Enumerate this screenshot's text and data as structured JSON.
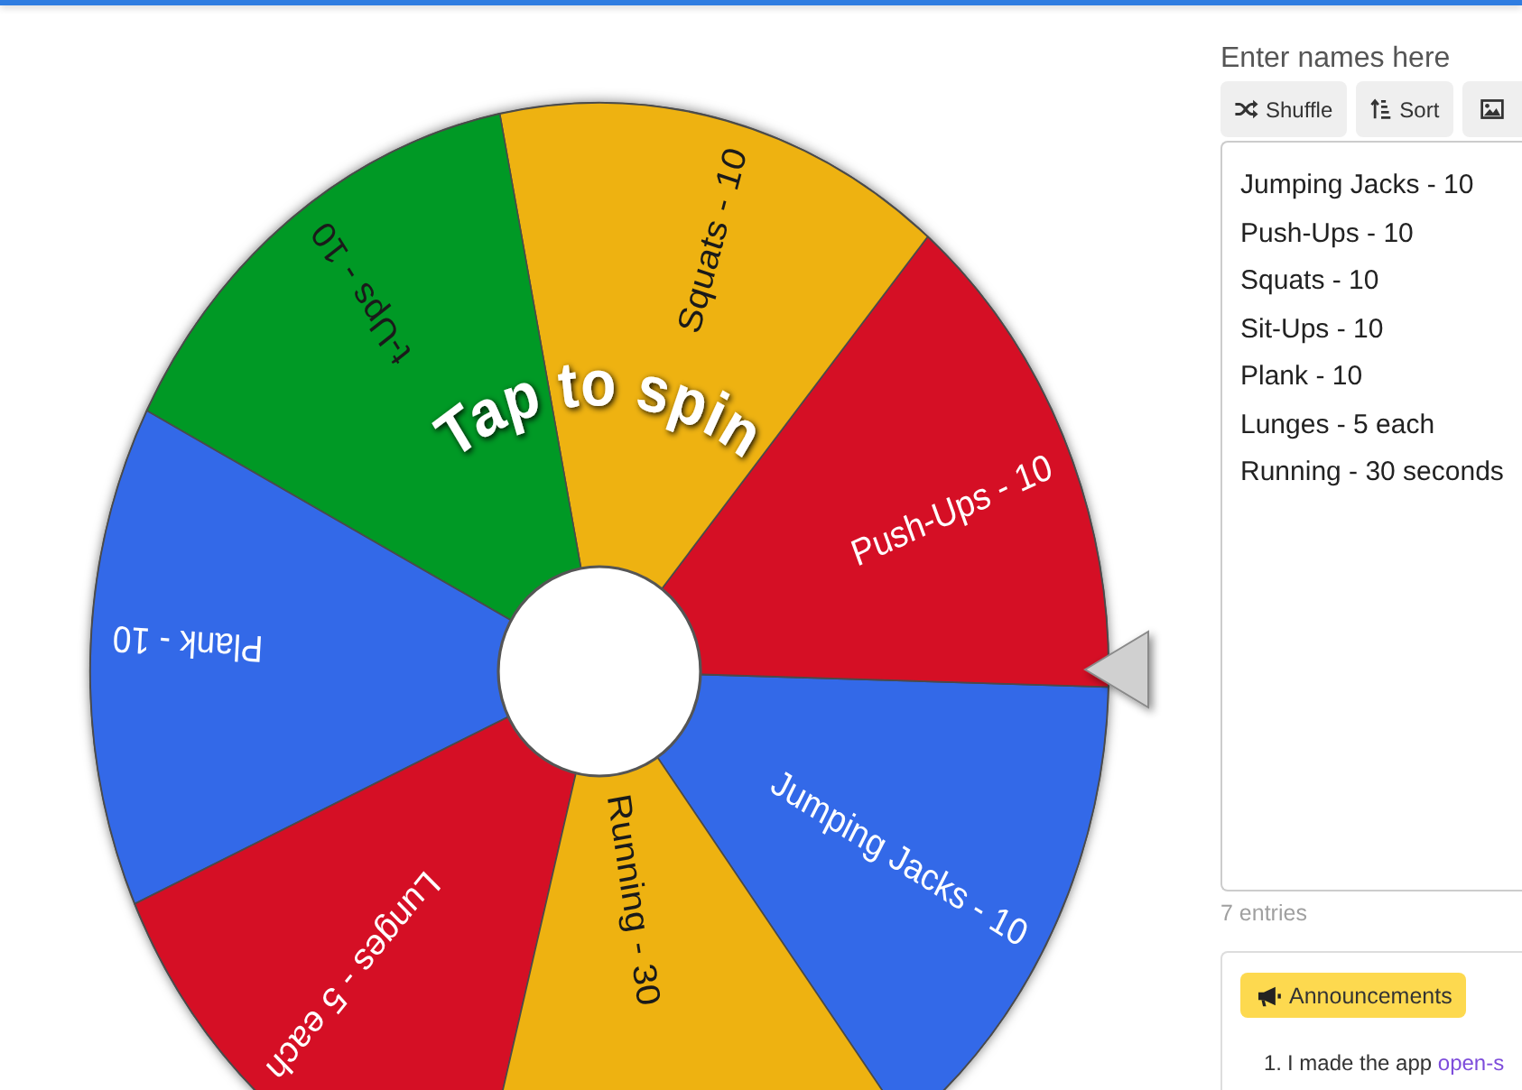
{
  "wheel": {
    "slices": [
      {
        "label": "Jumping Jacks - 10",
        "color": "#3369e8",
        "cut_off": false
      },
      {
        "label": "Push-Ups - 10",
        "color": "#d50f25",
        "cut_off": false
      },
      {
        "label": "Squats - 10",
        "color": "#eeb211",
        "cut_off": false
      },
      {
        "label": "t-Ups - 10",
        "color": "#009925",
        "cut_off": false
      },
      {
        "label": "Plank - 10",
        "color": "#3369e8",
        "cut_off": false
      },
      {
        "label": "Lunges - 5 each",
        "color": "#d50f25",
        "cut_off": false
      },
      {
        "label": "Running - 30",
        "color": "#eeb211",
        "cut_off": true
      }
    ],
    "hint": "Tap to spin"
  },
  "names_panel": {
    "title": "Enter names here",
    "buttons": [
      "Shuffle",
      "Sort"
    ],
    "entries": [
      "Jumping Jacks - 10",
      "Push-Ups - 10",
      "Squats - 10",
      "Sit-Ups - 10",
      "Plank - 10",
      "Lunges - 5 each",
      "Running - 30 seconds"
    ],
    "count": "7 entries"
  },
  "announcements": {
    "badge": "Announcements",
    "items": [
      {
        "number": "1.",
        "text": "I made the app",
        "link": "open-s"
      }
    ]
  }
}
